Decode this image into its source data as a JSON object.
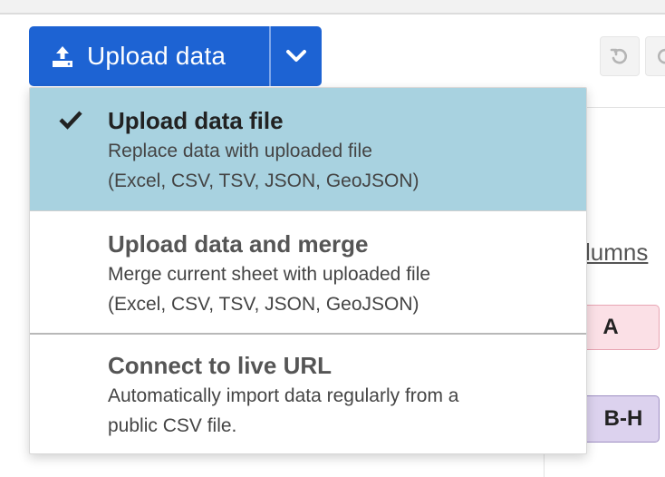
{
  "upload_button": {
    "label": "Upload data",
    "icon": "upload-icon",
    "dropdown_icon": "chevron-down-icon",
    "color": "#1d63d3"
  },
  "toolbar": {
    "undo_icon": "undo-icon",
    "redo_icon": "redo-icon"
  },
  "menu": {
    "items": [
      {
        "title": "Upload data file",
        "desc_line1": "Replace data with uploaded file",
        "desc_line2": "(Excel, CSV, TSV, JSON, GeoJSON)",
        "selected": true,
        "highlight_color": "#a8d2e0"
      },
      {
        "title": "Upload data and merge",
        "desc_line1": "Merge current sheet with uploaded file",
        "desc_line2": "(Excel, CSV, TSV, JSON, GeoJSON)",
        "selected": false
      },
      {
        "title": "Connect to live URL",
        "desc_line1": "Automatically import data regularly from a",
        "desc_line2": "public CSV file.",
        "selected": false
      }
    ]
  },
  "background": {
    "columns_link": "lumns",
    "pill_a": "A",
    "pill_bh": "B-H"
  }
}
